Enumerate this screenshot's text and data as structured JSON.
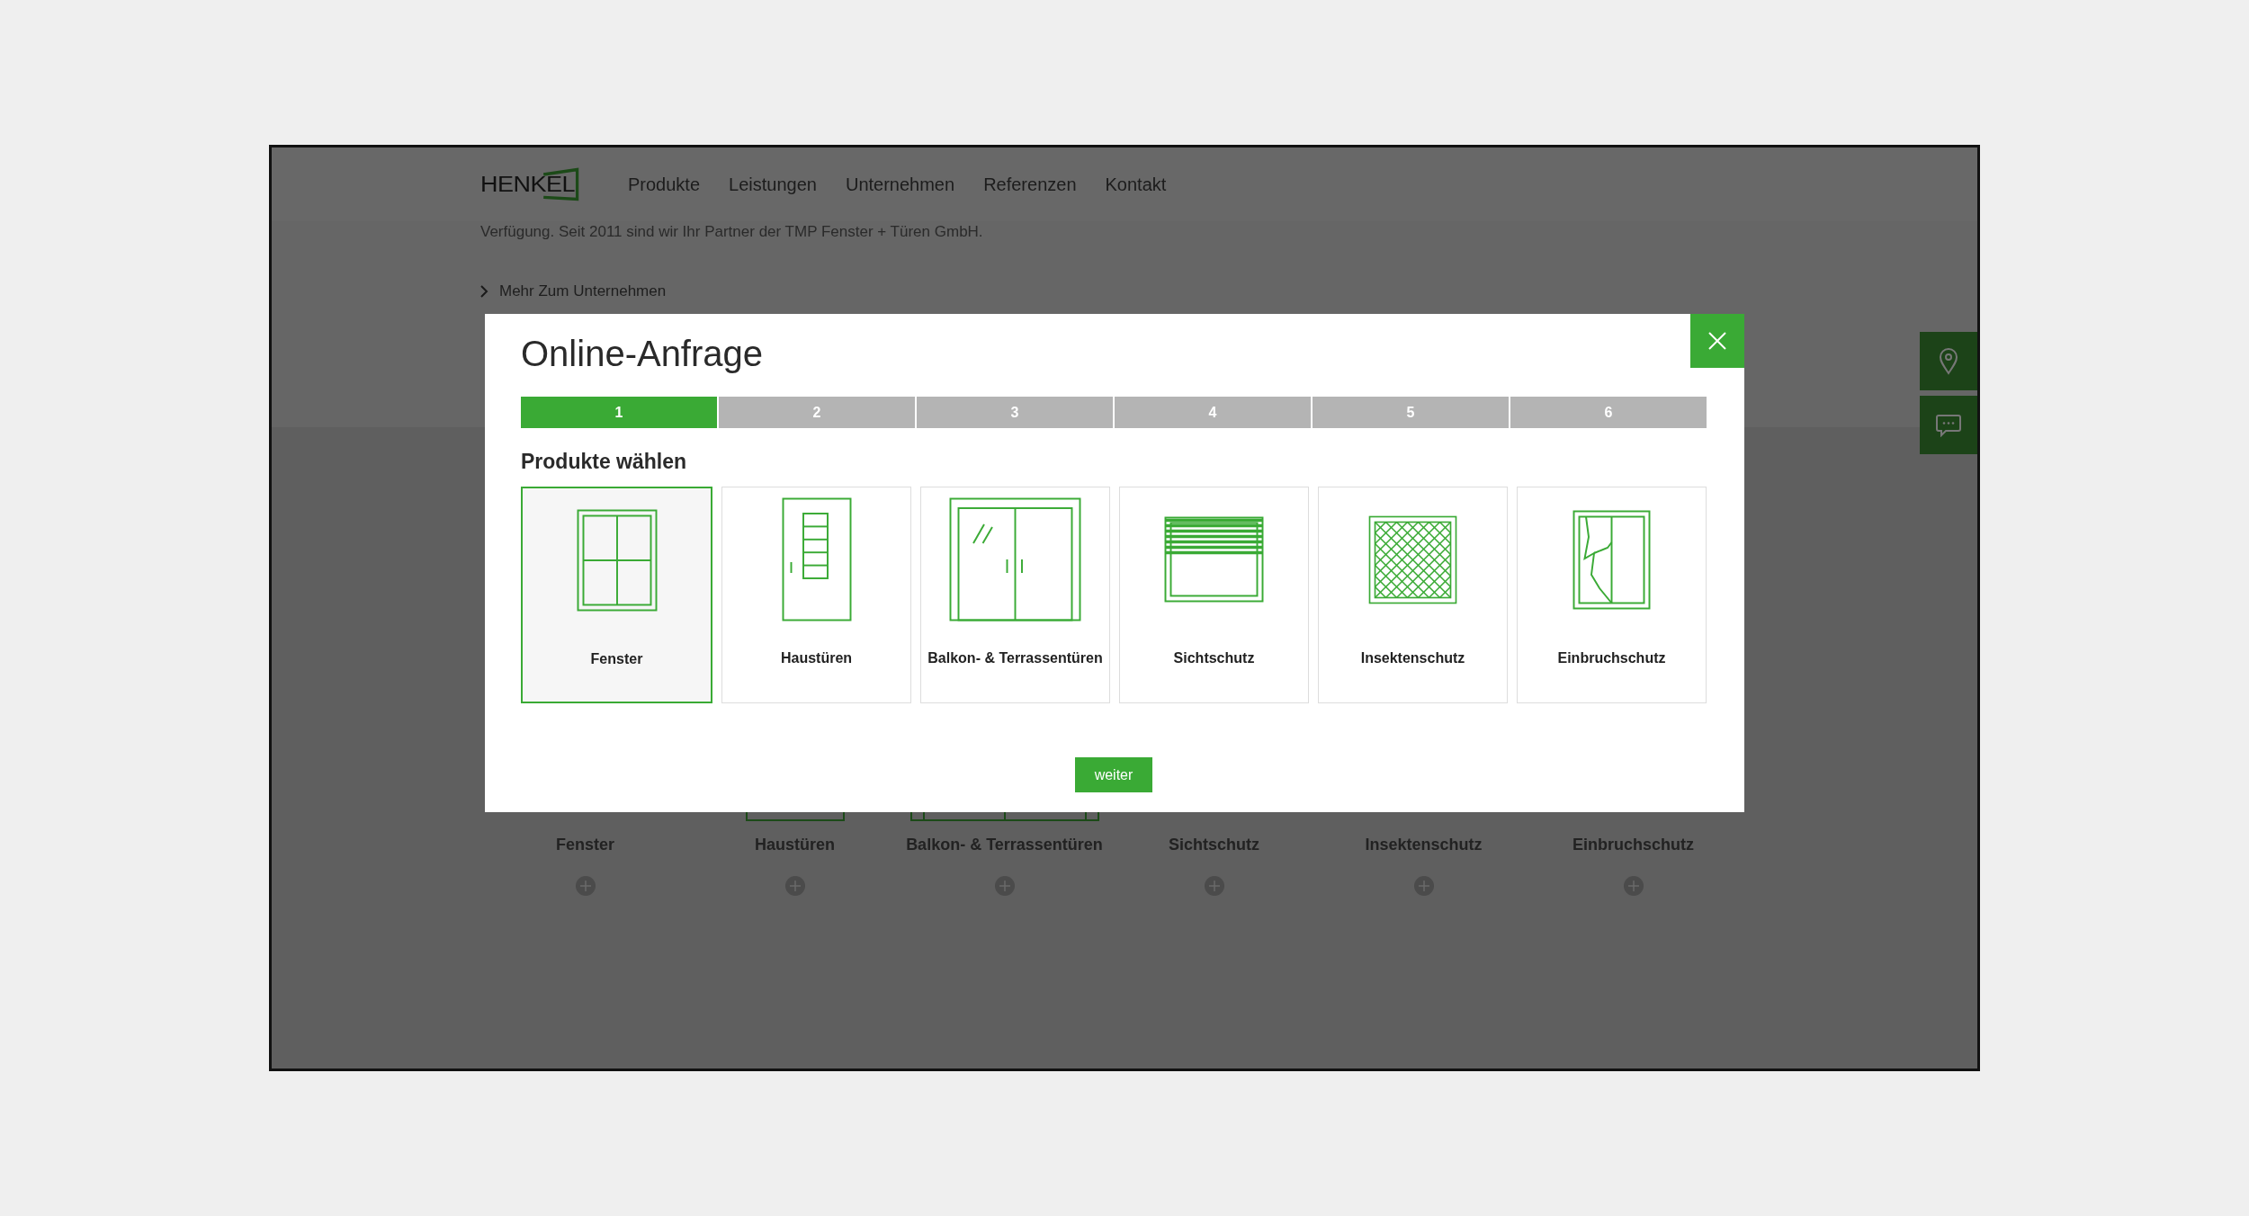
{
  "header": {
    "logo": "HENKEL",
    "nav": [
      "Produkte",
      "Leistungen",
      "Unternehmen",
      "Referenzen",
      "Kontakt"
    ]
  },
  "intro": {
    "text": "Verfügung. Seit 2011 sind wir Ihr Partner der TMP Fenster + Türen GmbH.",
    "link": "Mehr Zum Unternehmen"
  },
  "products": [
    {
      "label": "Fenster",
      "kind": "window"
    },
    {
      "label": "Haustüren",
      "kind": "door"
    },
    {
      "label": "Balkon- & Terrassentüren",
      "kind": "balcony"
    },
    {
      "label": "Sichtschutz",
      "kind": "blind"
    },
    {
      "label": "Insektenschutz",
      "kind": "insect"
    },
    {
      "label": "Einbruchschutz",
      "kind": "burglary"
    }
  ],
  "modal": {
    "title": "Online-Anfrage",
    "steps": [
      {
        "label": "1",
        "selected": true
      },
      {
        "label": "2",
        "selected": false
      },
      {
        "label": "3",
        "selected": false
      },
      {
        "label": "4",
        "selected": false
      },
      {
        "label": "5",
        "selected": false
      },
      {
        "label": "6",
        "selected": false
      }
    ],
    "heading": "Produkte wählen",
    "options": [
      {
        "label": "Fenster",
        "kind": "window",
        "selected": true
      },
      {
        "label": "Haustüren",
        "kind": "door",
        "selected": false
      },
      {
        "label": "Balkon- & Terrassentüren",
        "kind": "balcony",
        "selected": false
      },
      {
        "label": "Sichtschutz",
        "kind": "blind",
        "selected": false
      },
      {
        "label": "Insektenschutz",
        "kind": "insect",
        "selected": false
      },
      {
        "label": "Einbruchschutz",
        "kind": "burglary",
        "selected": false
      }
    ],
    "button": "weiter"
  }
}
